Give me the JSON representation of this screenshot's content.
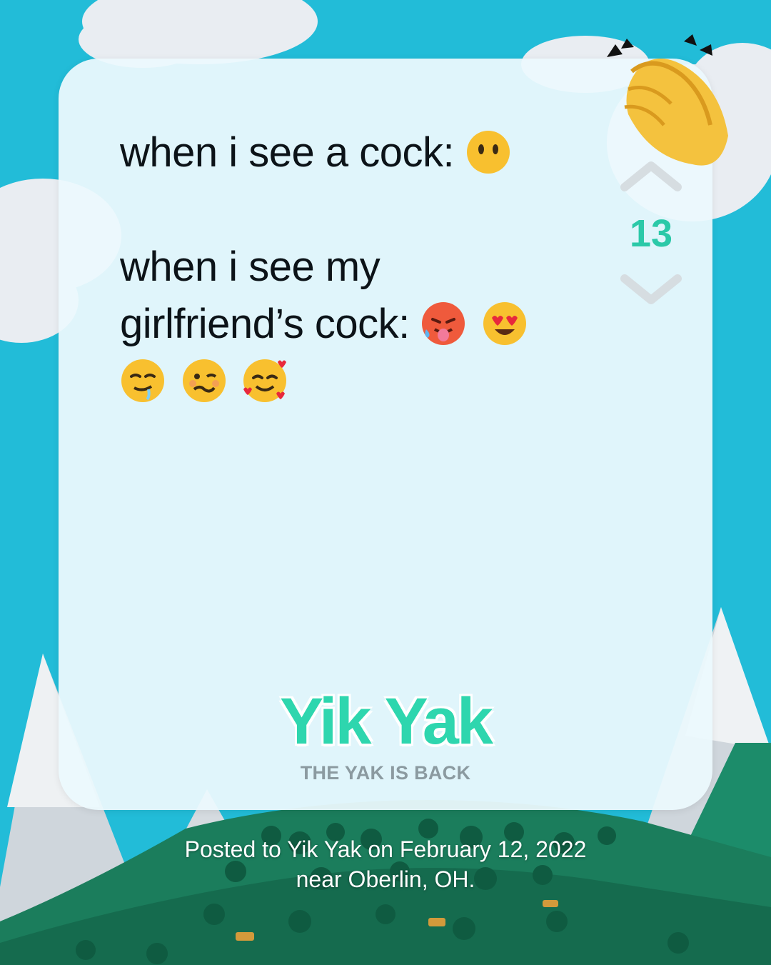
{
  "post": {
    "line1": "when i see a cock:",
    "line2": "when i see my",
    "line3": "girlfriend’s cock:"
  },
  "vote": {
    "count": "13",
    "upvote_icon": "chevron-up-icon",
    "downvote_icon": "chevron-down-icon"
  },
  "brand": {
    "logo": "Yik Yak",
    "tagline": "THE YAK IS BACK"
  },
  "caption": {
    "line1": "Posted to Yik Yak on February 12, 2022",
    "line2": "near Oberlin, OH."
  },
  "colors": {
    "background": "#22bcd8",
    "accent": "#2bc9a8",
    "card": "#ecf9fd"
  }
}
